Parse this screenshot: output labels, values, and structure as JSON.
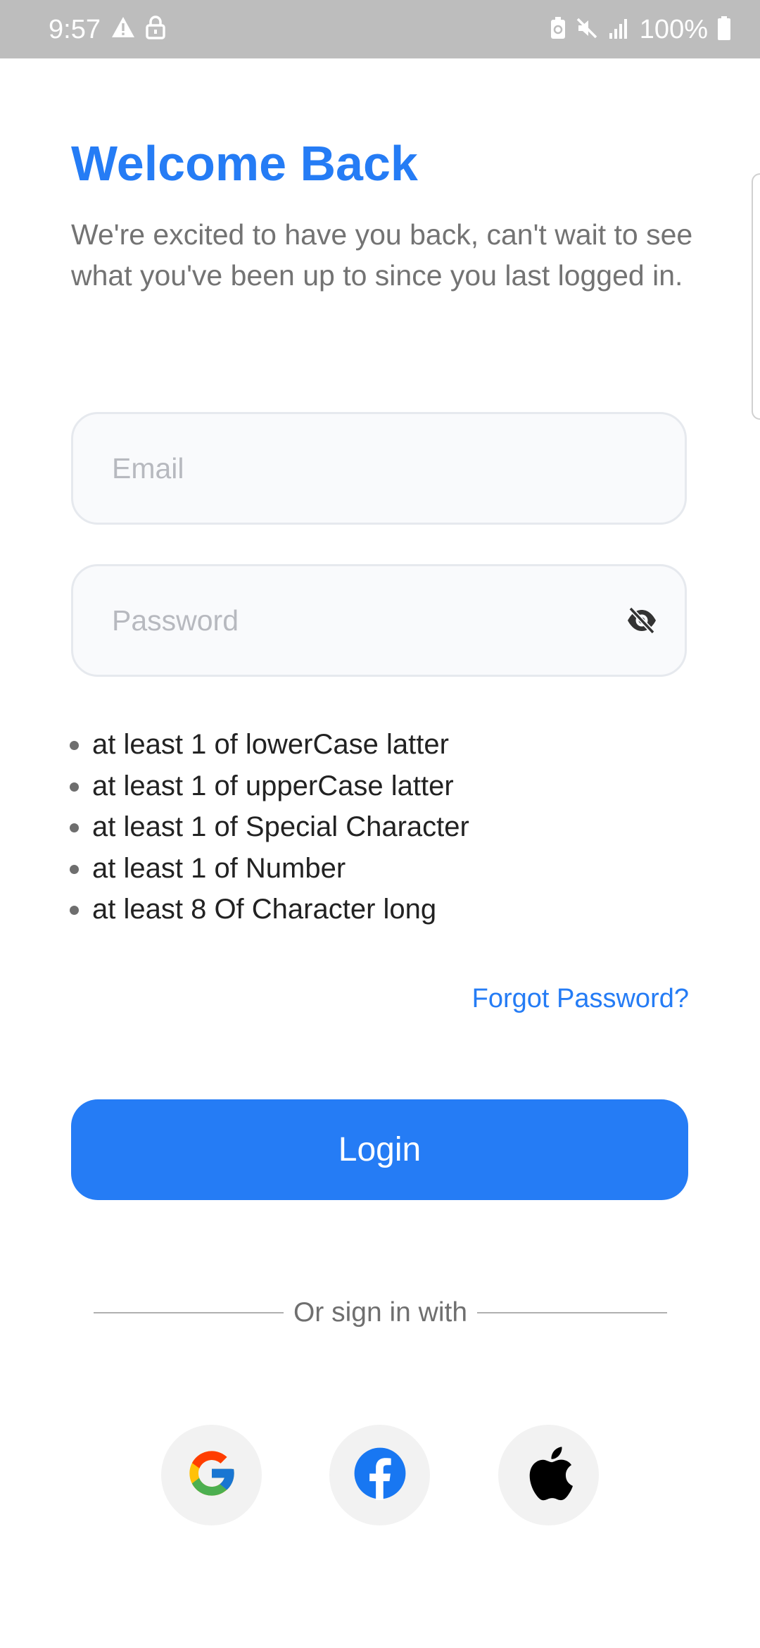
{
  "status_bar": {
    "time": "9:57",
    "battery": "100%",
    "icons": [
      "warning-icon",
      "lock-icon",
      "battery-saver-icon",
      "mute-icon",
      "signal-icon",
      "battery-icon"
    ]
  },
  "header": {
    "title": "Welcome Back",
    "subtitle": "We're excited to have you back, can't wait to see what you've been up to since you last logged in."
  },
  "form": {
    "email_placeholder": "Email",
    "email_value": "",
    "password_placeholder": "Password",
    "password_value": "",
    "password_toggle_icon": "eye-off-icon"
  },
  "password_rules": [
    "at least 1 of lowerCase latter",
    "at least 1 of upperCase latter",
    "at least 1 of Special Character",
    "at least 1 of Number",
    "at least 8 Of Character long"
  ],
  "forgot_password": "Forgot Password?",
  "login_button": "Login",
  "divider_text": "Or sign in with",
  "social": [
    {
      "provider": "google",
      "icon": "google-icon"
    },
    {
      "provider": "facebook",
      "icon": "facebook-icon"
    },
    {
      "provider": "apple",
      "icon": "apple-icon"
    }
  ],
  "colors": {
    "primary": "#257cf5",
    "status_bar": "#bdbdbd",
    "subtitle_text": "#737373",
    "field_background": "#f9fafc",
    "field_border": "#e6e9ee",
    "social_background": "#f2f2f2"
  }
}
